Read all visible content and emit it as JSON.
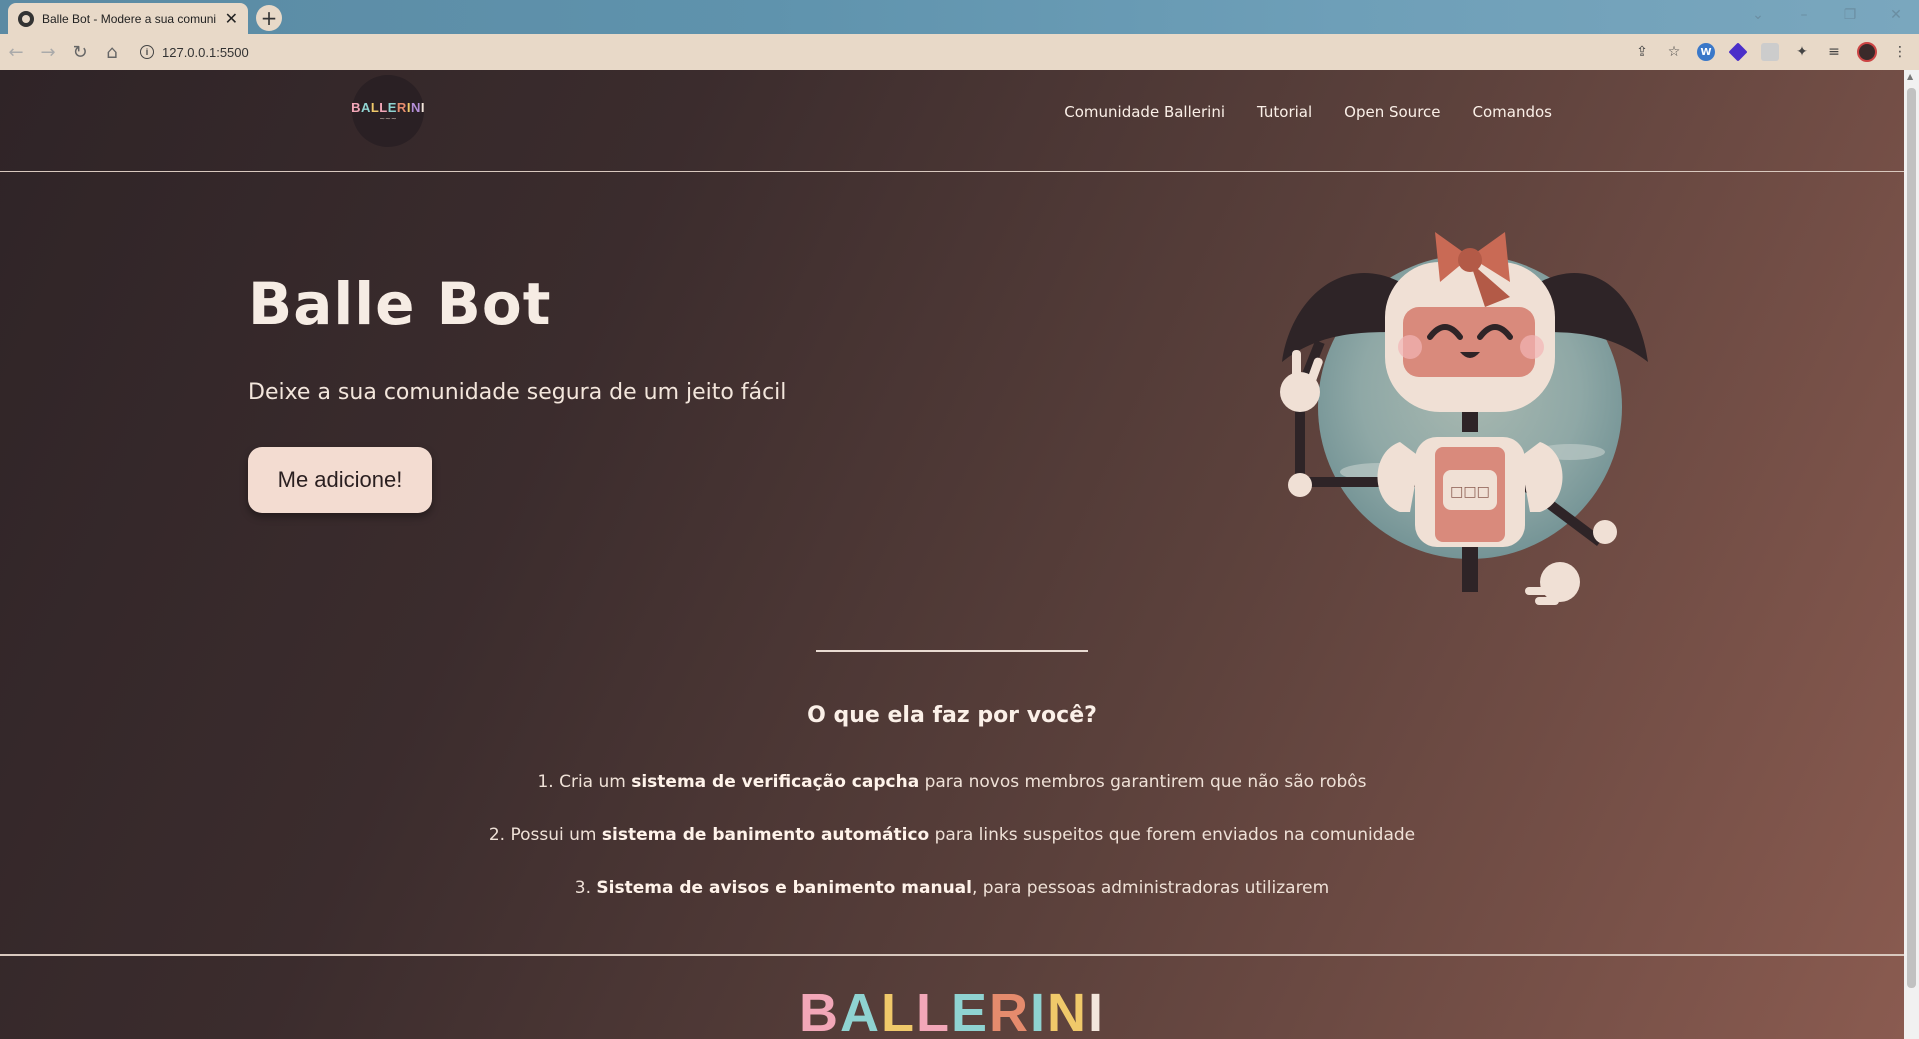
{
  "browser": {
    "tab_title": "Balle Bot - Modere a sua comuni",
    "tab_close": "✕",
    "new_tab": "+",
    "url": "127.0.0.1:5500"
  },
  "header": {
    "logo_text": "BALLERINI",
    "nav": [
      "Comunidade Ballerini",
      "Tutorial",
      "Open Source",
      "Comandos"
    ]
  },
  "hero": {
    "title": "Balle Bot",
    "subtitle": "Deixe a sua comunidade segura de um jeito fácil",
    "button_label": "Me adicione!",
    "robot_panel_text": "□□□"
  },
  "features": {
    "title": "O que ela faz por você?",
    "items": [
      {
        "prefix": "1. Cria um ",
        "bold": "sistema de verificação capcha",
        "suffix": " para novos membros garantirem que não são robôs"
      },
      {
        "prefix": "2. Possui um ",
        "bold": "sistema de banimento automático",
        "suffix": " para links suspeitos que forem enviados na comunidade"
      },
      {
        "prefix": "3. ",
        "bold": "Sistema de avisos e banimento manual",
        "suffix": ", para pessoas administradoras utilizarem"
      }
    ]
  },
  "footer": {
    "logo_text": "BALLERINI"
  },
  "colors": {
    "accent_pink": "#f2a7b8",
    "accent_teal": "#8fd3d1",
    "accent_yellow": "#f0c96a",
    "button_bg": "#f3dcd1"
  }
}
